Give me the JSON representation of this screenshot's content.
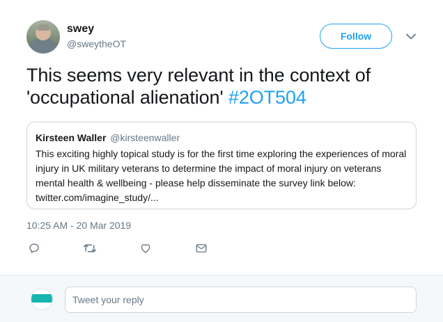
{
  "author": {
    "display_name": "swey",
    "handle": "@sweytheOT"
  },
  "follow_label": "Follow",
  "tweet": {
    "text": "This seems very relevant in the context of 'occupational alienation' ",
    "hashtag": "#2OT504",
    "timestamp": "10:25 AM - 20 Mar 2019"
  },
  "quoted_tweet": {
    "author_name": "Kirsteen Waller",
    "author_handle": "@kirsteenwaller",
    "text": "This exciting highly topical study is for the first time exploring the experiences of moral injury in UK military veterans to determine the impact of moral injury on veterans mental health & wellbeing - please help disseminate the survey link below: twitter.com/imagine_study/..."
  },
  "actions": {
    "reply_icon": "reply-icon",
    "retweet_icon": "retweet-icon",
    "like_icon": "heart-icon",
    "dm_icon": "envelope-icon"
  },
  "reply_box": {
    "placeholder": "Tweet your reply"
  },
  "colors": {
    "accent": "#1da1f2",
    "muted_text": "#657786",
    "border": "#ccd6dd",
    "reply_bar_bg": "#f5f8fa"
  }
}
